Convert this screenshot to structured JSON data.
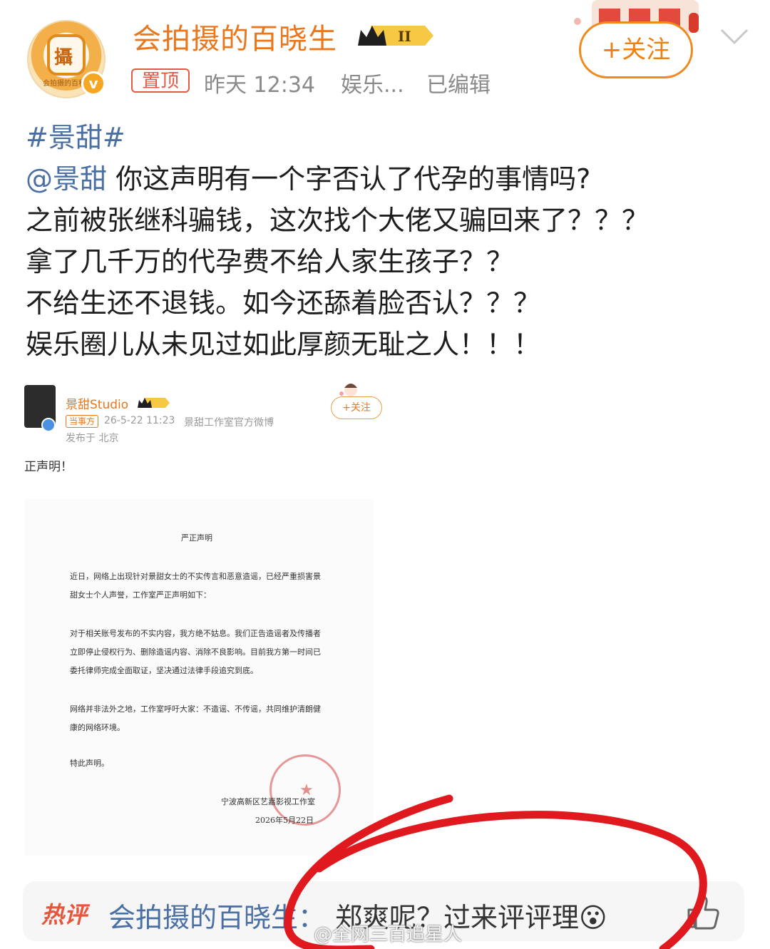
{
  "header": {
    "username": "会拍摄的百晓生",
    "level_badge": "II",
    "pinned_label": "置顶",
    "time": "昨天 12:34",
    "source": "娱乐...",
    "edited": "已编辑",
    "follow_label": "+关注",
    "avatar_text": "会拍摄的百科"
  },
  "post": {
    "topic": "#景甜#",
    "mention": "@景甜",
    "line1_rest": " 你这声明有一个字否认了代孕的事情吗?",
    "line2": "之前被张继科骗钱，这次找个大佬又骗回来了？？？",
    "line3": "拿了几千万的代孕费不给人家生孩子？？",
    "line4": "不给生还不退钱。如今还舔着脸否认？？？",
    "line5": "娱乐圈儿从未见过如此厚颜无耻之人！！！"
  },
  "embedded": {
    "name": "景甜Studio",
    "tag": "当事方",
    "time": "26-5-22 11:23",
    "source": "景甜工作室官方微博",
    "location": "发布于 北京",
    "follow_label": "+关注",
    "caption": "正声明！",
    "doc": {
      "title": "严正声明",
      "p1": "近日，网络上出现针对景甜女士的不实传言和恶意造谣，已经严重损害景甜女士个人声誉，工作室严正声明如下：",
      "p2": "对于相关账号发布的不实内容，我方绝不姑息。我们正告造谣者及传播者立即停止侵权行为、删除造谣内容、消除不良影响。目前我方第一时间已委托律师完成全面取证，坚决通过法律手段追究到底。",
      "p3": "网络并非法外之地，工作室呼吁大家：不造谣、不传谣，共同维护清朗健康的网络环境。",
      "p4": "特此声明。",
      "signature": "宁波高新区艺嘉影视工作室",
      "date": "2026年5月22日"
    }
  },
  "hot_comment": {
    "label": "热评",
    "user": "会拍摄的百晓生：",
    "text": "郑爽呢？过来评评理😮"
  },
  "watermark": "@全网三百追星人",
  "colors": {
    "brand_orange": "#e8771e",
    "link_blue": "#4a6fa5",
    "red_annotation": "#e0191f"
  }
}
